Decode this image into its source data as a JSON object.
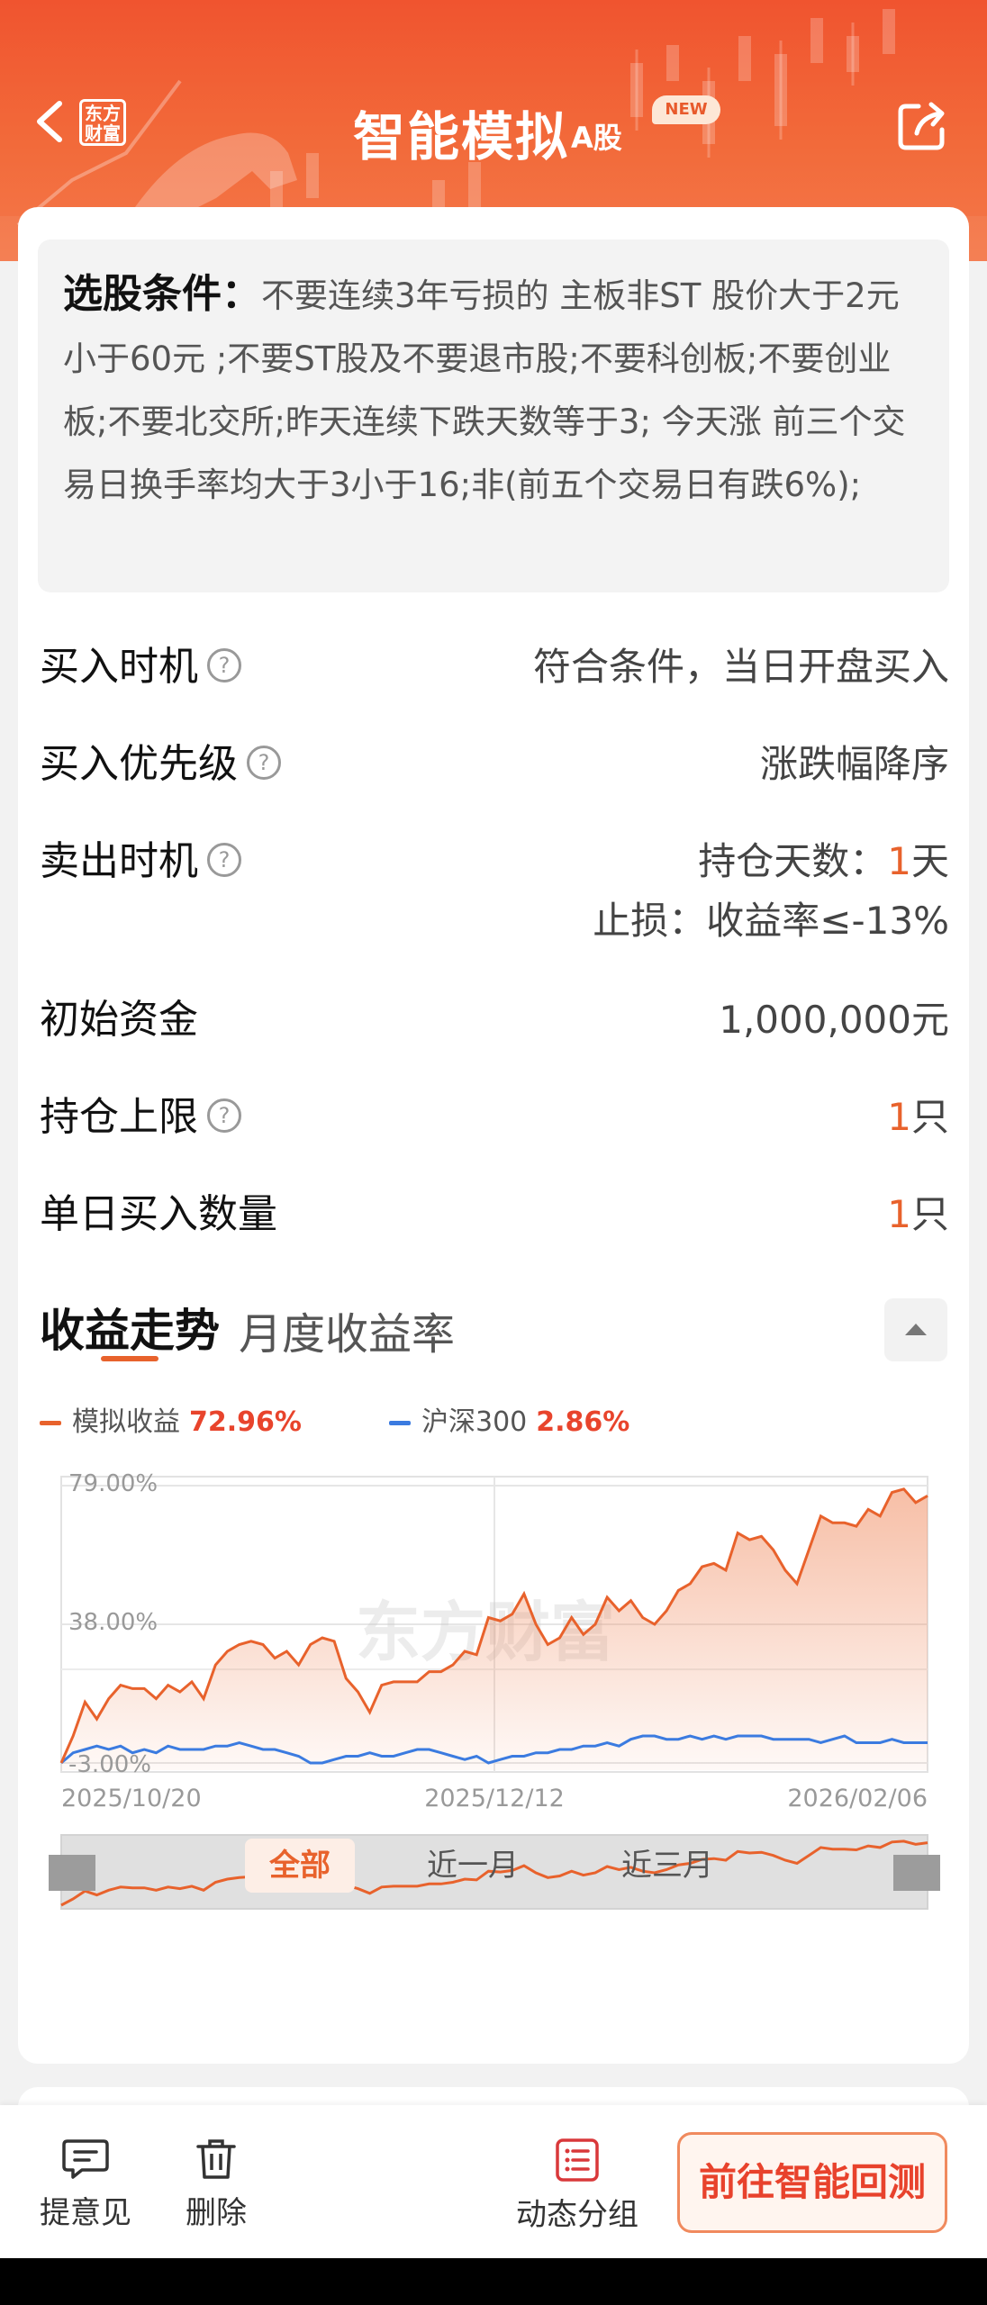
{
  "header": {
    "title": "智能模拟",
    "title_suffix": "A股",
    "new_badge": "NEW",
    "logo_text_line1": "东方",
    "logo_text_line2": "财富"
  },
  "conditions": {
    "label": "选股条件：",
    "text": "不要连续3年亏损的 主板非ST 股价大于2元小于60元 ;不要ST股及不要退市股;不要科创板;不要创业板;不要北交所;昨天连续下跌天数等于3;  今天涨 前三个交易日换手率均大于3小于16;非(前五个交易日有跌6%);"
  },
  "settings": {
    "buy_timing_label": "买入时机",
    "buy_timing_value": "符合条件，当日开盘买入",
    "buy_priority_label": "买入优先级",
    "buy_priority_value": "涨跌幅降序",
    "sell_timing_label": "卖出时机",
    "hold_days_prefix": "持仓天数：",
    "hold_days_num": "1",
    "hold_days_suffix": "天",
    "stop_loss": "止损：收益率≤-13%",
    "initial_capital_label": "初始资金",
    "initial_capital_value": "1,000,000元",
    "position_limit_label": "持仓上限",
    "position_limit_num": "1",
    "position_limit_unit": "只",
    "daily_buy_label": "单日买入数量",
    "daily_buy_num": "1",
    "daily_buy_unit": "只",
    "help_icon": "?"
  },
  "tabs": {
    "active": "收益走势",
    "second": "月度收益率"
  },
  "colors": {
    "accent": "#e8622c",
    "sim_line": "#e8622c",
    "hs300_line": "#3b7be0"
  },
  "chart_data": {
    "type": "line",
    "x": [
      "2025/10/20",
      "2025/12/12",
      "2026/02/06"
    ],
    "tick_labels_y": [
      "79.00%",
      "38.00%",
      "-3.00%"
    ],
    "ylim": [
      -3,
      79
    ],
    "series": [
      {
        "name": "模拟收益",
        "final_label": "72.96%",
        "values": [
          -3,
          5,
          15,
          10,
          16,
          20,
          19,
          19,
          16,
          20,
          18,
          21,
          16,
          26,
          30,
          32,
          33,
          32,
          28,
          30,
          26,
          32,
          34,
          33,
          22,
          18,
          12,
          20,
          21,
          21,
          21,
          24,
          24,
          26,
          30,
          29,
          40,
          39,
          41,
          47,
          38,
          32,
          34,
          40,
          35,
          38,
          46,
          42,
          45,
          40,
          38,
          42,
          48,
          50,
          55,
          56,
          54,
          65,
          63,
          64,
          60,
          54,
          50,
          60,
          70,
          68,
          68,
          67,
          72,
          70,
          77,
          78,
          74,
          76
        ]
      },
      {
        "name": "沪深300",
        "final_label": "2.86%",
        "values": [
          -3,
          0,
          1,
          2,
          1,
          2,
          0,
          1,
          0,
          2,
          1,
          1,
          1,
          2,
          2,
          3,
          2,
          1,
          1,
          0,
          -1,
          -3,
          -3,
          -2,
          -1,
          -1,
          0,
          -1,
          -1,
          0,
          1,
          1,
          0,
          -1,
          -2,
          -1,
          -3,
          -2,
          -1,
          -1,
          0,
          0,
          1,
          1,
          2,
          2,
          3,
          2,
          4,
          5,
          5,
          4,
          4,
          5,
          4,
          5,
          4,
          5,
          5,
          5,
          4,
          4,
          4,
          4,
          3,
          4,
          5,
          3,
          3,
          3,
          4,
          3,
          3,
          3
        ]
      }
    ],
    "watermark": "东方财富",
    "grid": true
  },
  "range_tabs": [
    "全部",
    "近一月",
    "近三月"
  ],
  "bottom_bar": {
    "feedback": "提意见",
    "delete": "删除",
    "group": "动态分组",
    "cta": "前往智能回测"
  }
}
